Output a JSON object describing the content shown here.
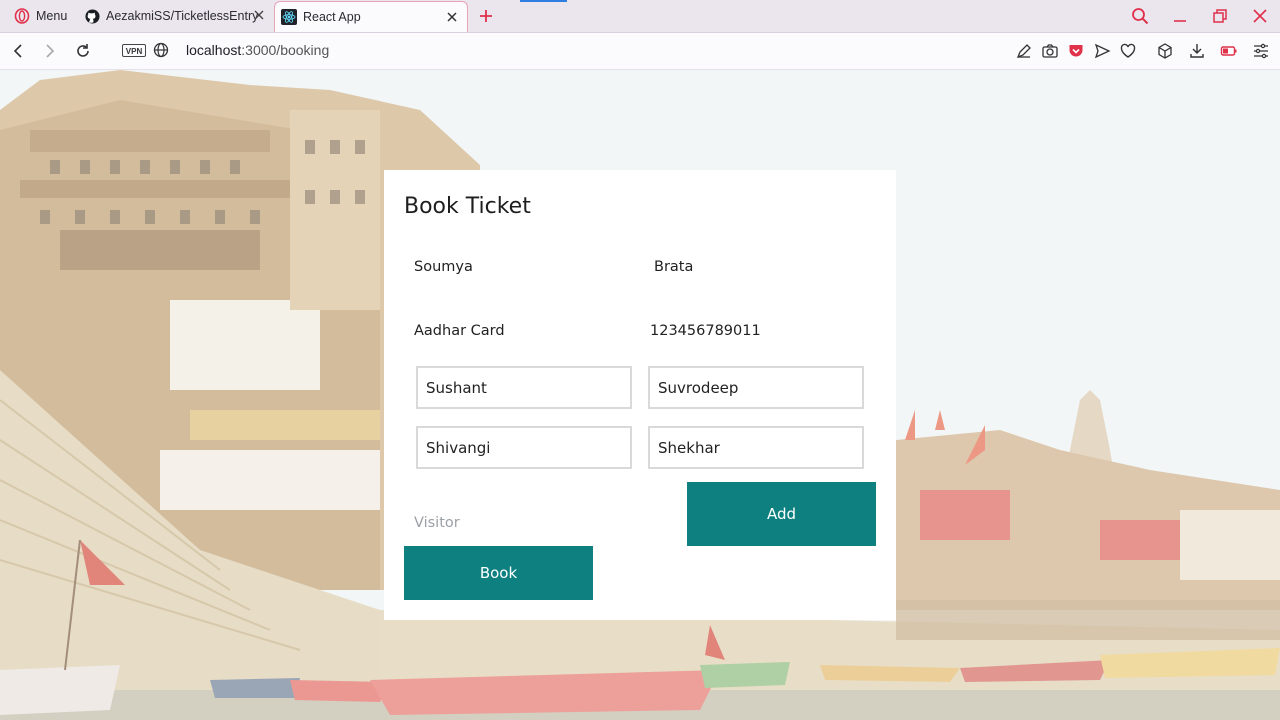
{
  "browser": {
    "tabs": [
      {
        "label": "Menu"
      },
      {
        "label": "AezakmiSS/TicketlessEntry"
      },
      {
        "label": "React App"
      }
    ],
    "url_host": "localhost",
    "url_rest": ":3000/booking",
    "vpn_label": "VPN",
    "accent": "#e0314b"
  },
  "booking": {
    "title": "Book Ticket",
    "first_name": "Soumya",
    "last_name": "Brata",
    "id_type": "Aadhar Card",
    "id_number": "123456789011",
    "visitors": [
      {
        "first": "Sushant",
        "last": "Suvrodeep"
      },
      {
        "first": "Shivangi",
        "last": "Shekhar"
      }
    ],
    "visitor_placeholder": "Visitor",
    "add_label": "Add",
    "book_label": "Book",
    "button_color": "#0f8080"
  }
}
